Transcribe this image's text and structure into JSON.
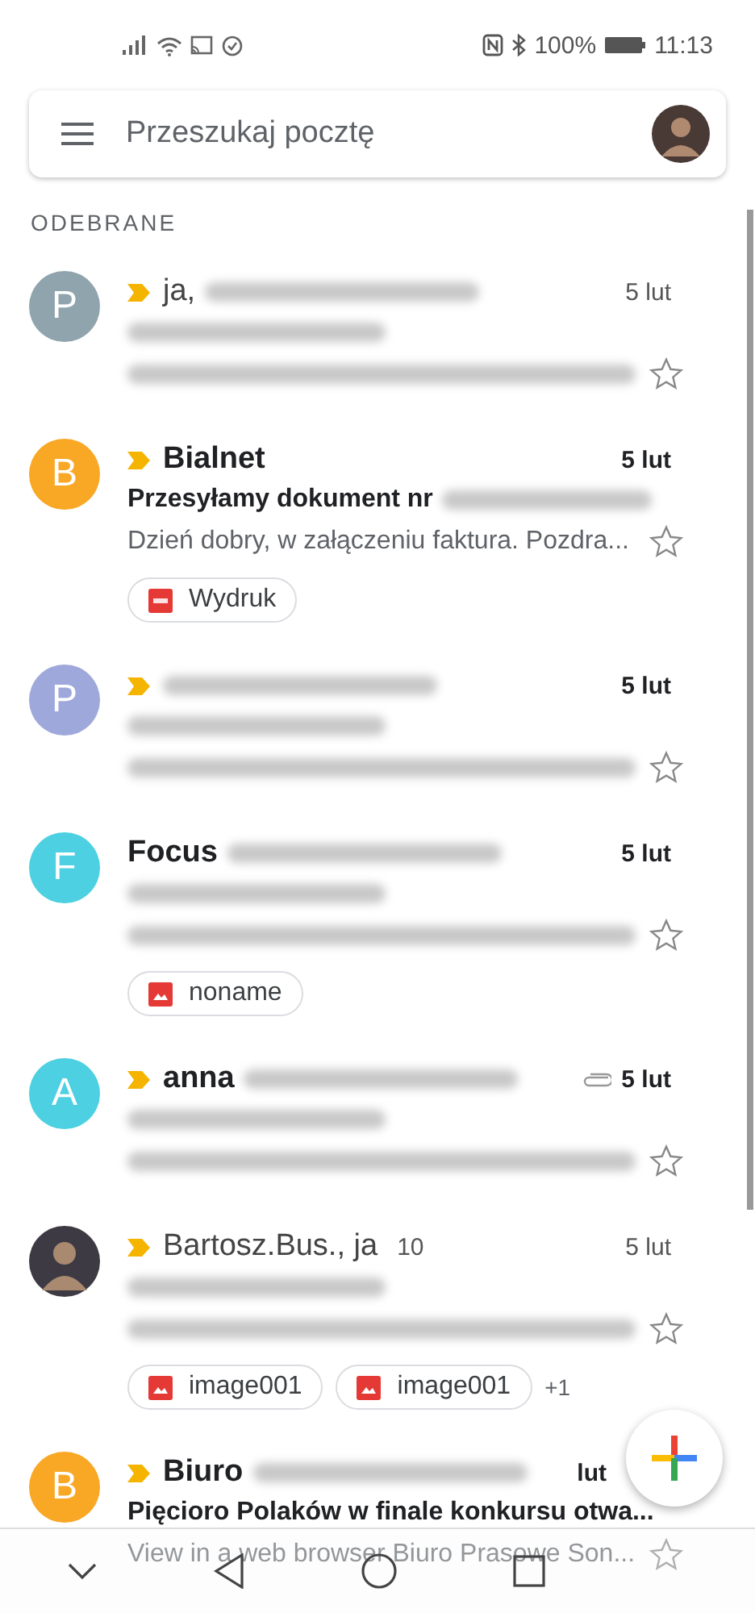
{
  "status_bar": {
    "battery": "100%",
    "time": "11:13"
  },
  "search": {
    "placeholder": "Przeszukaj pocztę"
  },
  "section_label": "ODEBRANE",
  "emails": [
    {
      "avatar": {
        "kind": "letter",
        "letter": "P",
        "color": "#90a4ae"
      },
      "important": true,
      "unread": false,
      "sender": "ja,",
      "sender_blurred": true,
      "date": "5 lut",
      "subject_blurred": true,
      "snippet_blurred": true,
      "starred": false
    },
    {
      "avatar": {
        "kind": "letter",
        "letter": "B",
        "color": "#f9a825"
      },
      "important": true,
      "unread": true,
      "sender": "Bialnet",
      "date": "5 lut",
      "subject": "Przesyłamy dokument nr",
      "subject_blurred": true,
      "snippet": "Dzień dobry, w załączeniu faktura. Pozdra...",
      "starred": false,
      "attachments": [
        {
          "kind": "pdf",
          "name": "Wydruk"
        }
      ]
    },
    {
      "avatar": {
        "kind": "letter",
        "letter": "P",
        "color": "#9fa8da"
      },
      "important": true,
      "unread": true,
      "sender_blurred": true,
      "date": "5 lut",
      "subject_blurred": true,
      "snippet_blurred": true,
      "starred": false
    },
    {
      "avatar": {
        "kind": "letter",
        "letter": "F",
        "color": "#4dd0e1"
      },
      "important": false,
      "unread": true,
      "sender": "Focus",
      "sender_blurred": true,
      "date": "5 lut",
      "subject_blurred": true,
      "snippet_blurred": true,
      "starred": false,
      "attachments": [
        {
          "kind": "image",
          "name": "noname"
        }
      ]
    },
    {
      "avatar": {
        "kind": "letter",
        "letter": "A",
        "color": "#4dd0e1"
      },
      "important": true,
      "unread": true,
      "sender": "anna",
      "sender_blurred": true,
      "has_clip": true,
      "date": "5 lut",
      "subject_blurred": true,
      "snippet_blurred": true,
      "starred": false
    },
    {
      "avatar": {
        "kind": "photo"
      },
      "important": true,
      "unread": false,
      "sender": "Bartosz.Bus., ja",
      "count": "10",
      "date": "5 lut",
      "subject_blurred": true,
      "snippet_blurred": true,
      "starred": false,
      "attachments": [
        {
          "kind": "image",
          "name": "image001"
        },
        {
          "kind": "image",
          "name": "image001"
        }
      ],
      "more": "+1"
    },
    {
      "avatar": {
        "kind": "letter",
        "letter": "B",
        "color": "#f9a825"
      },
      "important": true,
      "unread": true,
      "sender": "Biuro",
      "sender_blurred": true,
      "date": "lut",
      "subject": "Pięcioro Polaków w finale konkursu otwa...",
      "snippet": "View in a web browser Biuro Prasowe Son...",
      "starred": false
    }
  ]
}
